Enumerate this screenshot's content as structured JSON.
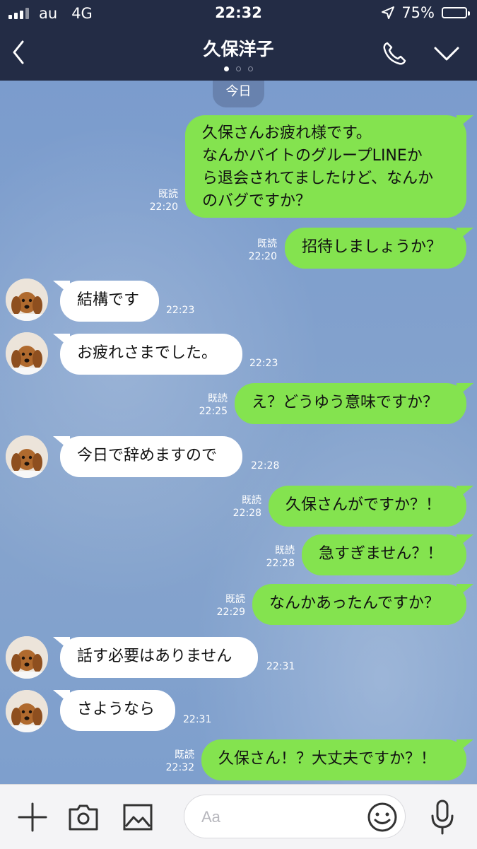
{
  "status_bar": {
    "carrier": "au",
    "network": "4G",
    "time": "22:32",
    "battery": "75%",
    "battery_level": 0.75
  },
  "header": {
    "title": "久保洋子",
    "back_icon": "chevron-left-icon",
    "call_icon": "phone-icon",
    "menu_icon": "chevron-down-icon",
    "page_dots": 3,
    "active_dot": 0
  },
  "chat": {
    "date_label": "今日",
    "messages": [
      {
        "sender": "me",
        "lines": [
          "久保さんお疲れ様です。",
          "なんかバイトのグループLINEか",
          "ら退会されてましたけど、なんか",
          "のバグですか？"
        ],
        "read": "既読",
        "time": "22:20"
      },
      {
        "sender": "me",
        "lines": [
          "招待しましょうか？"
        ],
        "read": "既読",
        "time": "22:20"
      },
      {
        "sender": "them",
        "lines": [
          "結構です"
        ],
        "time": "22:23"
      },
      {
        "sender": "them",
        "lines": [
          "お疲れさまでした。"
        ],
        "time": "22:23"
      },
      {
        "sender": "me",
        "lines": [
          "え？どうゆう意味ですか？"
        ],
        "read": "既読",
        "time": "22:25"
      },
      {
        "sender": "them",
        "lines": [
          "今日で辞めますので"
        ],
        "time": "22:28"
      },
      {
        "sender": "me",
        "lines": [
          "久保さんがですか？！"
        ],
        "read": "既読",
        "time": "22:28"
      },
      {
        "sender": "me",
        "lines": [
          "急すぎません？！"
        ],
        "read": "既読",
        "time": "22:28"
      },
      {
        "sender": "me",
        "lines": [
          "なんかあったんですか？"
        ],
        "read": "既読",
        "time": "22:29"
      },
      {
        "sender": "them",
        "lines": [
          "話す必要はありません"
        ],
        "time": "22:31"
      },
      {
        "sender": "them",
        "lines": [
          "さようなら"
        ],
        "time": "22:31"
      },
      {
        "sender": "me",
        "lines": [
          "久保さん！？大丈夫ですか？！"
        ],
        "read": "既読",
        "time": "22:32"
      }
    ]
  },
  "input_bar": {
    "placeholder": "Aa",
    "icons": [
      "plus-icon",
      "camera-icon",
      "image-icon",
      "emoji-icon",
      "microphone-icon"
    ]
  },
  "colors": {
    "header_bg": "#232c45",
    "my_bubble": "#84e34f",
    "their_bubble": "#ffffff",
    "chat_bg": "#7f9dc9"
  }
}
